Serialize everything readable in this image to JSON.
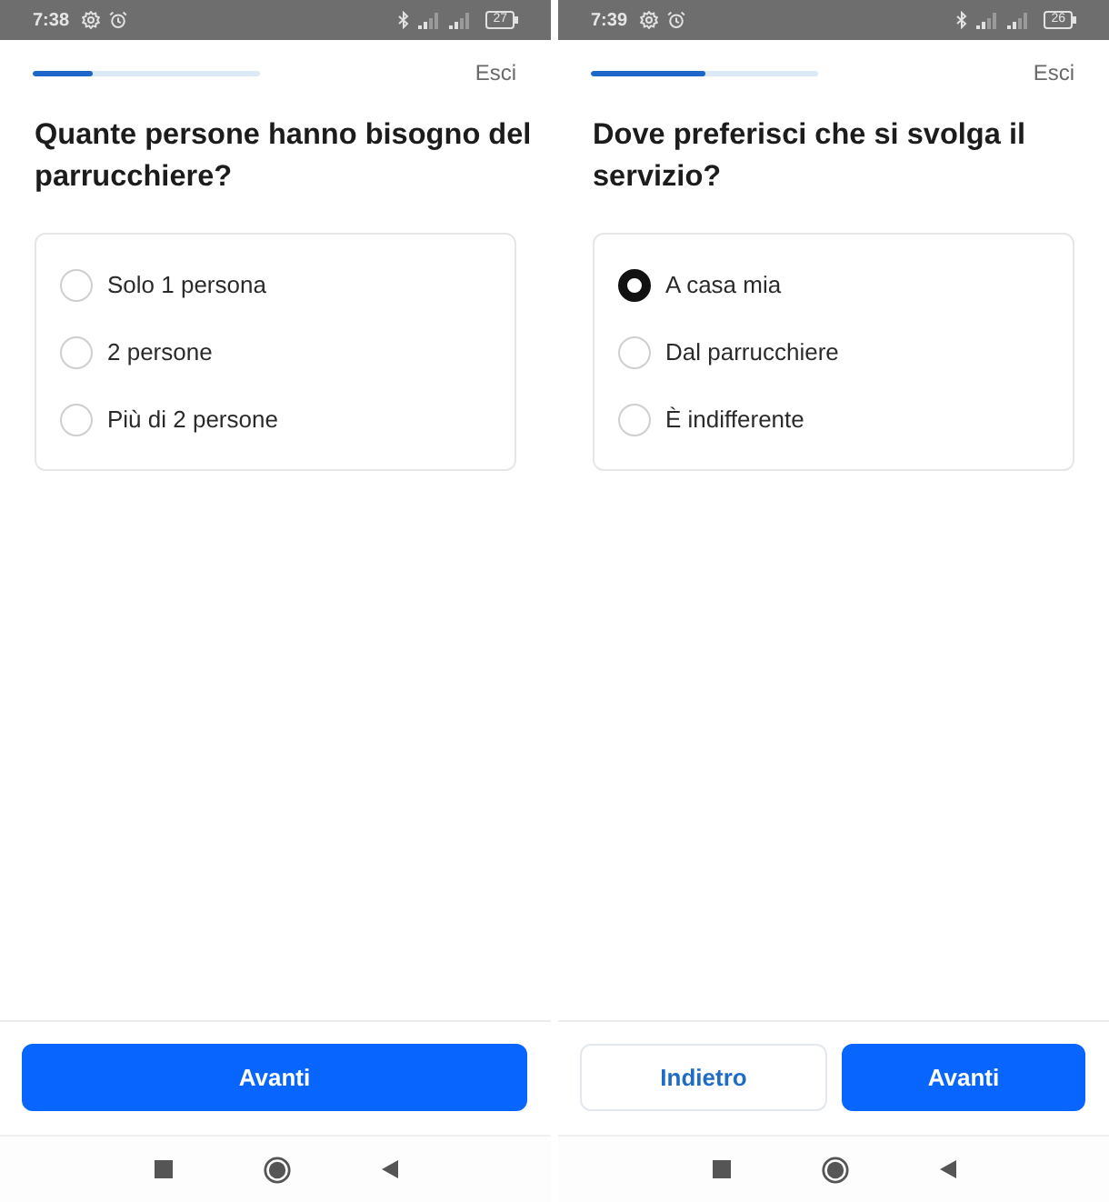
{
  "screens": [
    {
      "status_bar": {
        "time": "7:38",
        "battery": "27"
      },
      "progress": {
        "level": 0.26
      },
      "exit_link": "Esci",
      "question": "Quante persone hanno bisogno del parrucchiere?",
      "options": [
        {
          "label": "Solo 1 persona",
          "selected": false
        },
        {
          "label": "2 persone",
          "selected": false
        },
        {
          "label": "Più di 2 persone",
          "selected": false
        }
      ],
      "buttons": [
        {
          "label": "Avanti",
          "kind": "primary"
        }
      ]
    },
    {
      "status_bar": {
        "time": "7:39",
        "battery": "26"
      },
      "progress": {
        "level": 0.5
      },
      "exit_link": "Esci",
      "question": "Dove preferisci che si svolga il servizio?",
      "options": [
        {
          "label": "A casa mia",
          "selected": true
        },
        {
          "label": "Dal parrucchiere",
          "selected": false
        },
        {
          "label": "È indifferente",
          "selected": false
        }
      ],
      "buttons": [
        {
          "label": "Indietro",
          "kind": "secondary"
        },
        {
          "label": "Avanti",
          "kind": "primary"
        }
      ]
    }
  ]
}
